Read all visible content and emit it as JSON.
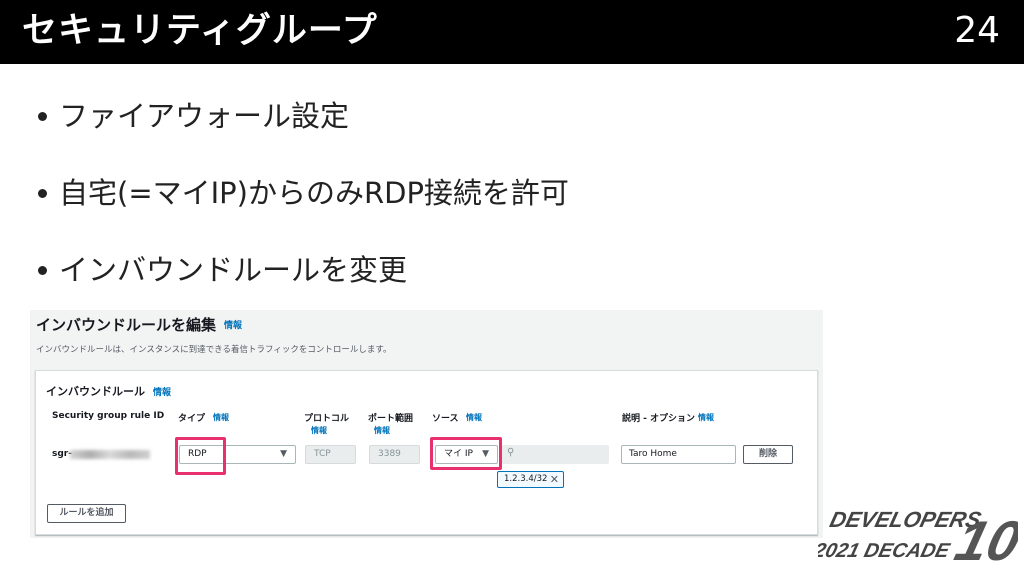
{
  "slide": {
    "title": "セキュリティグループ",
    "page_number": "24",
    "bullets": [
      "ファイアウォール設定",
      "自宅(=マイIP)からのみRDP接続を許可",
      "インバウンドルールを変更"
    ]
  },
  "console": {
    "heading": "インバウンドルールを編集",
    "info": "情報",
    "description": "インバウンドルールは、インスタンスに到達できる着信トラフィックをコントロールします。",
    "panel_title": "インバウンドルール",
    "columns": {
      "rule_id": "Security group rule ID",
      "type": "タイプ",
      "protocol": "プロトコル",
      "port_range": "ポート範囲",
      "source": "ソース",
      "description": "説明 - オプション"
    },
    "row": {
      "rule_id_prefix": "sgr-",
      "type": "RDP",
      "protocol": "TCP",
      "port": "3389",
      "source": "マイ IP",
      "source_search": "",
      "source_token": "1.2.3.4/32",
      "description": "Taro Home",
      "delete_label": "削除"
    },
    "add_rule_label": "ルールを追加",
    "highlight_color": "#e8306e"
  },
  "logo": {
    "line1": "DEVELOPERS",
    "line2": "2021 DECADE",
    "number": "10"
  }
}
